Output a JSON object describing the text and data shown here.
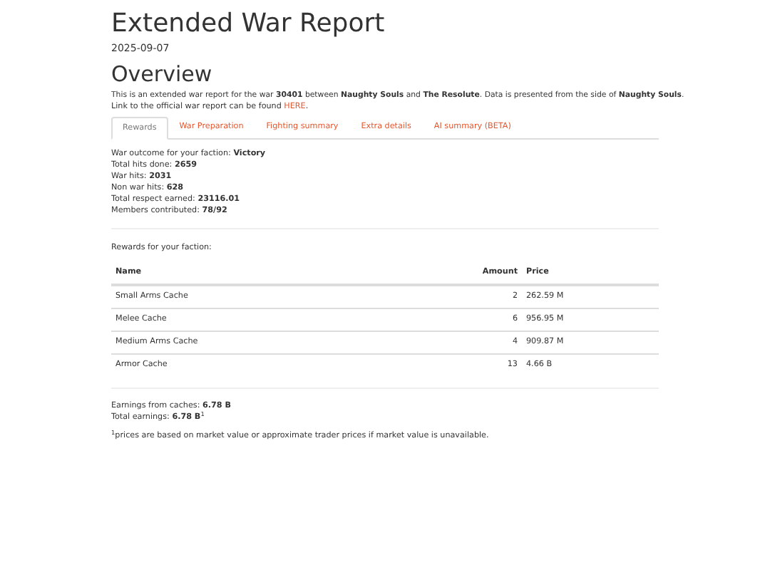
{
  "title": "Extended War Report",
  "date": "2025-09-07",
  "overview": {
    "heading": "Overview",
    "intro": "This is an extended war report for the war **30401** between **Naughty Souls** and **The Resolute**. Data is presented from the side of **Naughty Souls**.",
    "link_text": "Link to the official war report can be found ",
    "link": "HERE",
    "link_after": "."
  },
  "tabs": [
    {
      "label": "Rewards",
      "selected": true
    },
    {
      "label": "War Preparation",
      "selected": false
    },
    {
      "label": "Fighting summary",
      "selected": false
    },
    {
      "label": "Extra details",
      "selected": false
    },
    {
      "label": "AI summary (BETA)",
      "selected": false
    }
  ],
  "stats": [
    "War outcome for your faction: **Victory**",
    "Total hits done: **2659**",
    "War hits: **2031**",
    "Non war hits: **628**",
    "Total respect earned: **23116.01**",
    "Members contributed: **78/92**"
  ],
  "rewards_caption": "Rewards for your faction:",
  "table": {
    "columns": [
      "Name",
      "Amount",
      "Price"
    ],
    "rows": [
      [
        "Small Arms Cache",
        "2",
        "262.59 M"
      ],
      [
        "Melee Cache",
        "6",
        "956.95 M"
      ],
      [
        "Medium Arms Cache",
        "4",
        "909.87 M"
      ],
      [
        "Armor Cache",
        "13",
        "4.66 B"
      ]
    ]
  },
  "earnings": [
    "Earnings from caches: **6.78 B**",
    "Total earnings: **6.78 B**$^{1}$"
  ],
  "footnote": "$^{1}$prices are based on market value or approximate trader prices if market value is unavailable."
}
